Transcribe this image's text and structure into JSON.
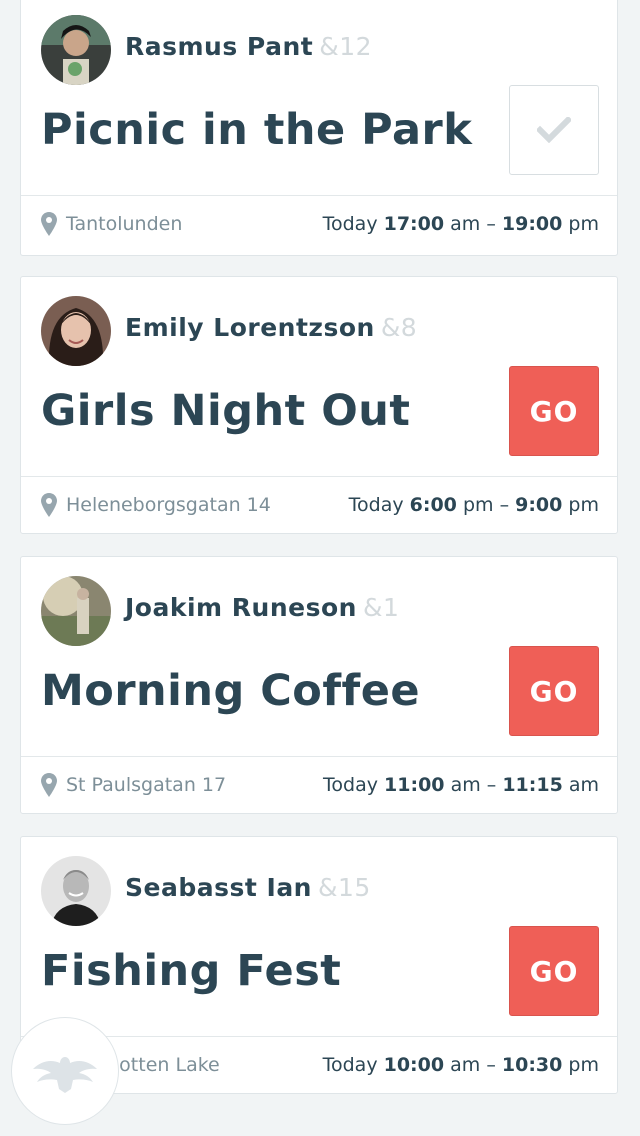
{
  "events": [
    {
      "host": "Rasmus Pant",
      "count": "&12",
      "title": "Picnic in the Park",
      "action": "check",
      "location": "Tantolunden",
      "day": "Today",
      "start_time": "17:00",
      "start_period": "am",
      "end_time": "19:00",
      "end_period": "pm"
    },
    {
      "host": "Emily Lorentzson",
      "count": "&8",
      "title": "Girls Night Out",
      "action": "go",
      "action_label": "GO",
      "location": "Heleneborgsgatan 14",
      "day": "Today",
      "start_time": "6:00",
      "start_period": "pm",
      "end_time": "9:00",
      "end_period": "pm"
    },
    {
      "host": "Joakim Runeson",
      "count": "&1",
      "title": "Morning Coffee",
      "action": "go",
      "action_label": "GO",
      "location": "St Paulsgatan 17",
      "day": "Today",
      "start_time": "11:00",
      "start_period": "am",
      "end_time": "11:15",
      "end_period": "am"
    },
    {
      "host": "Seabasst Ian",
      "count": "&15",
      "title": "Fishing Fest",
      "action": "go",
      "action_label": "GO",
      "location": "Norrbotten Lake",
      "location_visible": "rbotten Lake",
      "day": "Today",
      "start_time": "10:00",
      "start_period": "am",
      "end_time": "10:30",
      "end_period": "pm"
    }
  ],
  "time_separator": "–",
  "fab": {
    "icon": "bird-logo-icon"
  },
  "colors": {
    "background": "#f1f4f5",
    "card": "#ffffff",
    "text_primary": "#2c4654",
    "text_muted": "#7d8f98",
    "count": "#d3d9dc",
    "go_button": "#ef5f57"
  }
}
